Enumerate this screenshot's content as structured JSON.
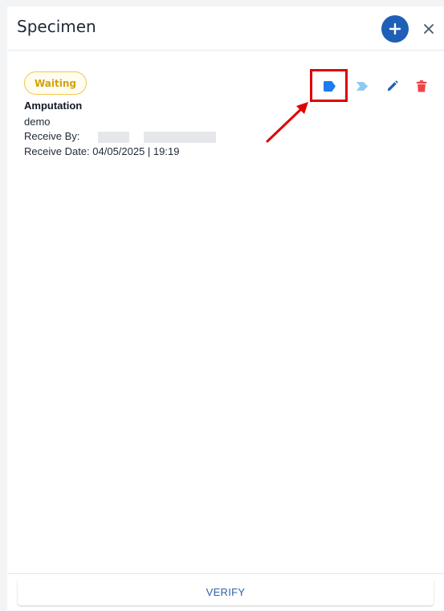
{
  "header": {
    "title": "Specimen",
    "add_icon": "plus-icon",
    "close_icon": "close-icon"
  },
  "specimen": {
    "status": "Waiting",
    "name": "Amputation",
    "note": "demo",
    "receive_by_label": "Receive By:",
    "receive_date_label": "Receive Date: 04/05/2025 | 19:19",
    "actions": [
      "label-tag-icon",
      "next-step-icon",
      "edit-pencil-icon",
      "delete-trash-icon"
    ]
  },
  "footer": {
    "verify_label": "VERIFY"
  },
  "colors": {
    "primary": "#1f5fb7",
    "tag_blue": "#1e7bf0",
    "light_blue": "#8ec9f3",
    "danger": "#ef4444",
    "waiting": "#d4a106",
    "highlight": "#e00000"
  }
}
